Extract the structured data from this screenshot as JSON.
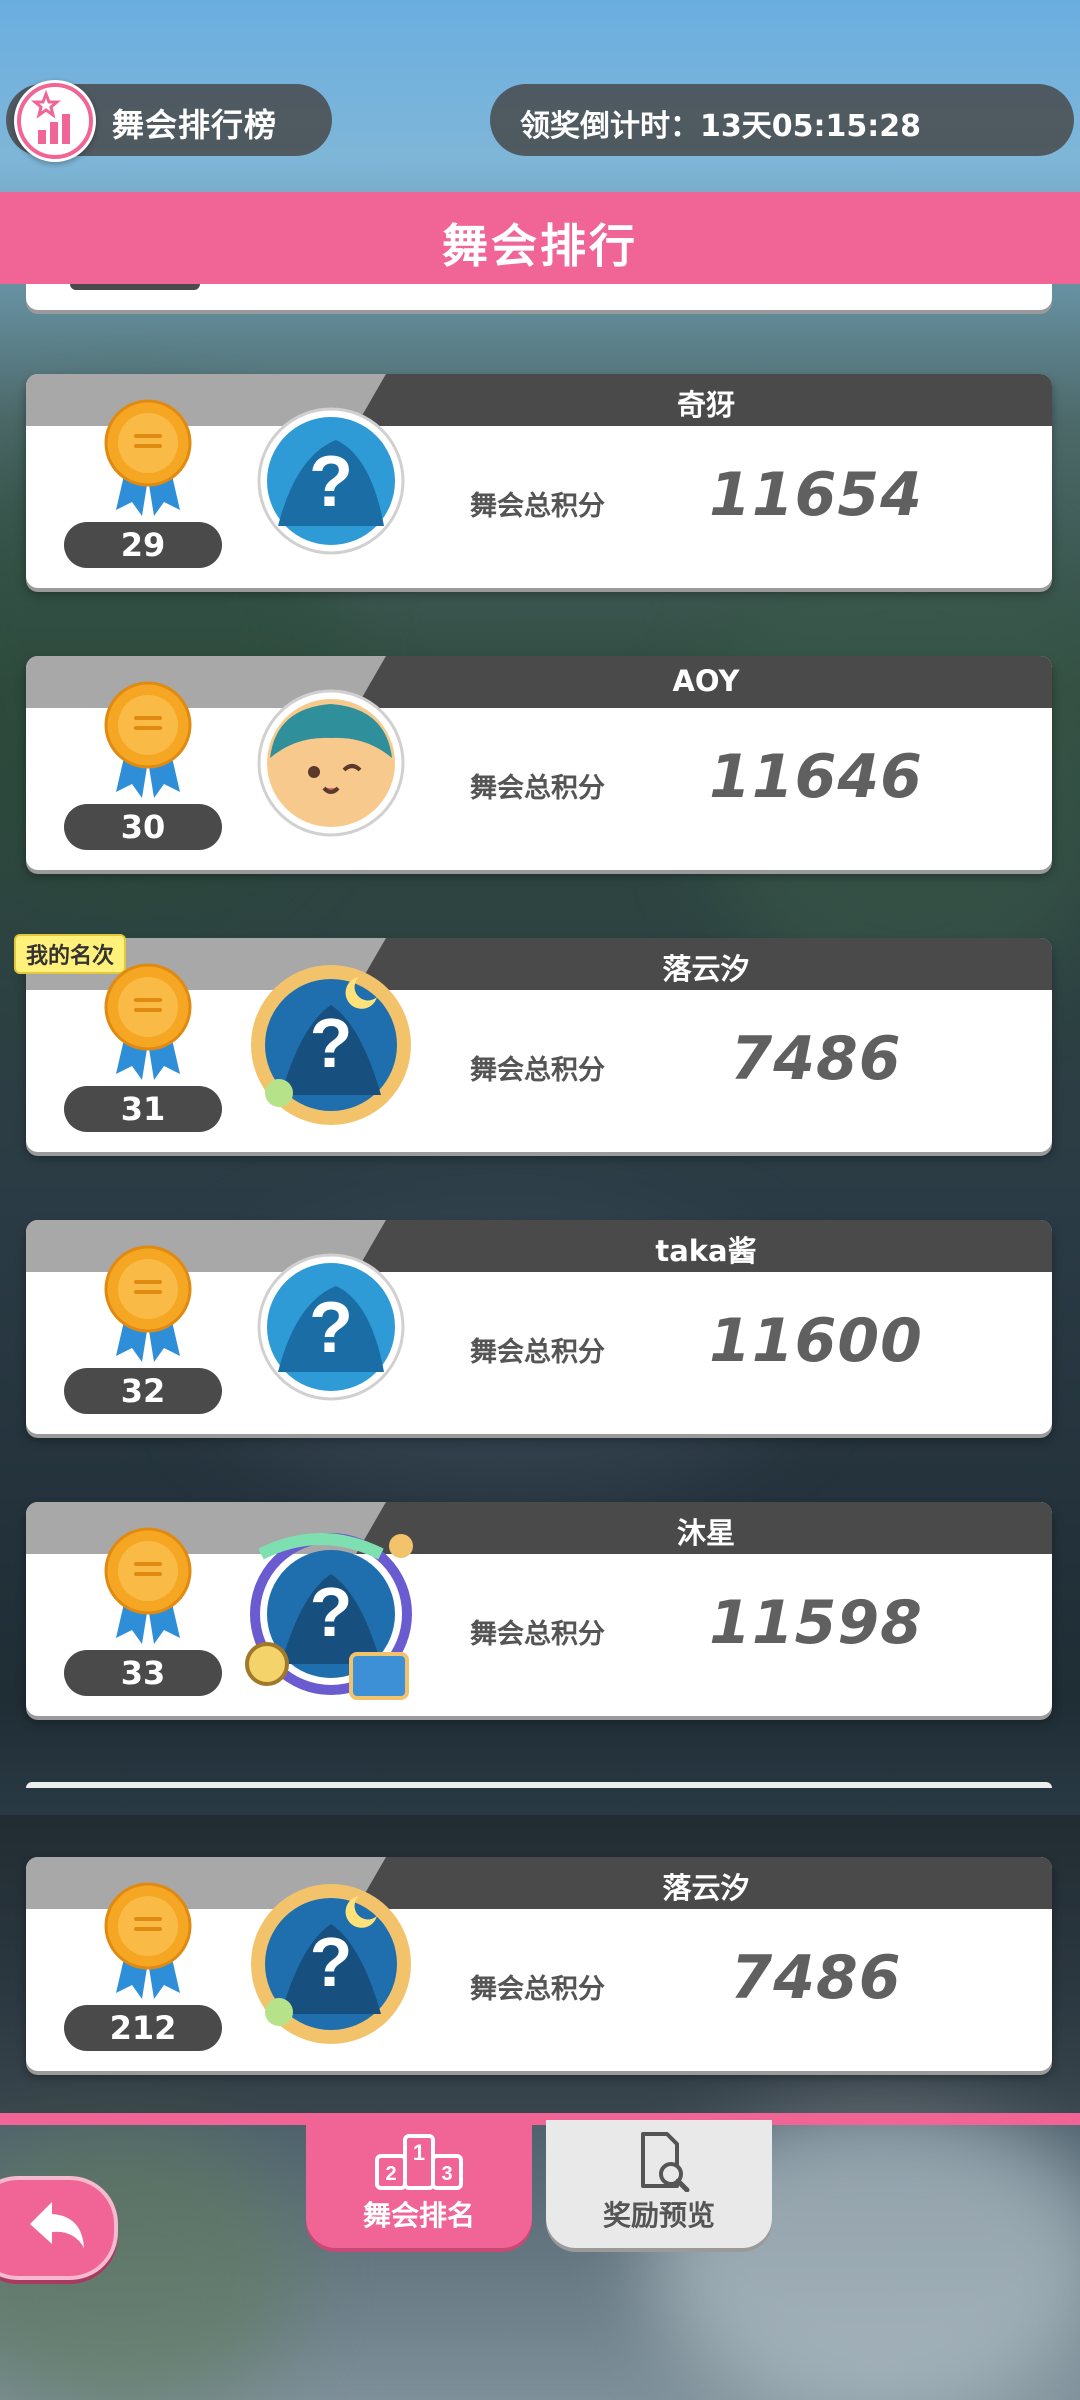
{
  "header": {
    "title": "舞会排行榜",
    "timer_label": "领奖倒计时：",
    "timer_value": "13天05:15:28"
  },
  "band_title": "舞会排行",
  "score_label": "舞会总积分",
  "my_rank_tag": "我的名次",
  "entries": [
    {
      "name": "奇犽",
      "rank": "29",
      "score": "11654",
      "avatar": "question-avatar-icon"
    },
    {
      "name": "AOY",
      "rank": "30",
      "score": "11646",
      "avatar": "cat-avatar-icon"
    },
    {
      "name": "落云汐",
      "rank": "31",
      "score": "7486",
      "avatar": "moon-frame-avatar-icon",
      "is_me": true
    },
    {
      "name": "taka酱",
      "rank": "32",
      "score": "11600",
      "avatar": "question-avatar-icon"
    },
    {
      "name": "沐星",
      "rank": "33",
      "score": "11598",
      "avatar": "treasure-frame-avatar-icon"
    }
  ],
  "my_entry": {
    "name": "落云汐",
    "rank": "212",
    "score": "7486",
    "avatar": "moon-frame-avatar-icon"
  },
  "tabs": [
    {
      "label": "舞会排名",
      "icon": "podium-icon",
      "active": true
    },
    {
      "label": "奖励预览",
      "icon": "document-search-icon",
      "active": false
    }
  ],
  "back_button": {
    "icon": "back-arrow-icon"
  },
  "colors": {
    "accent": "#f06595",
    "dark": "#4a4a4a",
    "medal_gold": "#f5a623",
    "ribbon_blue": "#2e8fd8"
  }
}
